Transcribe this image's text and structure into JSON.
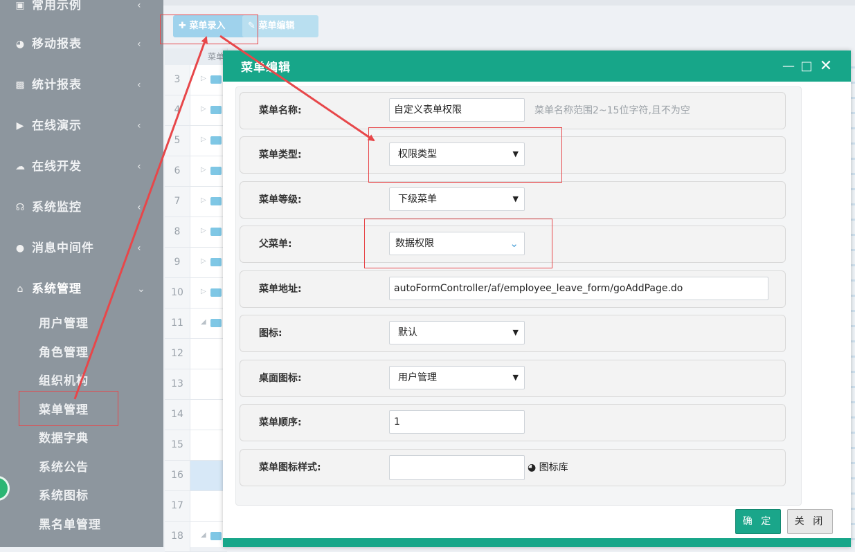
{
  "sidebar": {
    "items": [
      {
        "label": "常用示例",
        "icon": "book-icon"
      },
      {
        "label": "移动报表",
        "icon": "pie-chart-icon"
      },
      {
        "label": "统计报表",
        "icon": "bar-chart-icon"
      },
      {
        "label": "在线演示",
        "icon": "play-circle-icon"
      },
      {
        "label": "在线开发",
        "icon": "cloud-icon"
      },
      {
        "label": "系统监控",
        "icon": "headset-icon"
      },
      {
        "label": "消息中间件",
        "icon": "chat-icon"
      },
      {
        "label": "系统管理",
        "icon": "home-icon"
      }
    ],
    "sub_items": [
      "用户管理",
      "角色管理",
      "组织机构",
      "菜单管理",
      "数据字典",
      "系统公告",
      "系统图标",
      "黑名单管理"
    ]
  },
  "toolbar": {
    "add_label": "菜单录入",
    "edit_label": "菜单编辑"
  },
  "grid": {
    "header": "菜单",
    "rows": [
      "3",
      "4",
      "5",
      "6",
      "7",
      "8",
      "9",
      "10",
      "11",
      "12",
      "13",
      "14",
      "15",
      "16",
      "17",
      "18"
    ]
  },
  "dialog": {
    "title": "菜单编辑",
    "fields": {
      "name": {
        "label": "菜单名称:",
        "value": "自定义表单权限",
        "hint": "菜单名称范围2~15位字符,且不为空"
      },
      "type": {
        "label": "菜单类型:",
        "value": "权限类型"
      },
      "level": {
        "label": "菜单等级:",
        "value": "下级菜单"
      },
      "parent": {
        "label": "父菜单:",
        "value": "数据权限"
      },
      "url": {
        "label": "菜单地址:",
        "value": "autoFormController/af/employee_leave_form/goAddPage.do"
      },
      "icon": {
        "label": "图标:",
        "value": "默认"
      },
      "desktop_icon": {
        "label": "桌面图标:",
        "value": "用户管理"
      },
      "order": {
        "label": "菜单顺序:",
        "value": "1"
      },
      "icon_style": {
        "label": "菜单图标样式:",
        "value": "",
        "library_label": "图标库"
      }
    },
    "ok_label": "确 定",
    "close_label": "关 闭"
  },
  "colors": {
    "accent": "#17a689",
    "sidebar": "#8d969e",
    "annotation": "#e7474a"
  }
}
